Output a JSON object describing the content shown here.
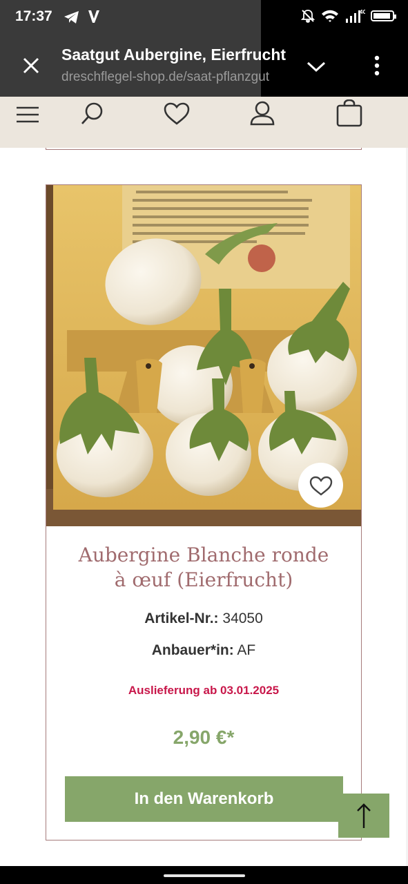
{
  "status_bar": {
    "time": "17:37",
    "left_icons": [
      "telegram-icon",
      "v-app-icon"
    ],
    "right_icons": [
      "mute-icon",
      "wifi-icon",
      "signal-icon",
      "battery-icon"
    ],
    "network": "4G"
  },
  "browser": {
    "title": "Saatgut Aubergine, Eierfrucht",
    "url": "dreschflegel-shop.de/saat-pflanzgut"
  },
  "site_nav": {
    "icons": [
      "menu-icon",
      "search-icon",
      "heart-icon",
      "user-icon",
      "bag-icon"
    ]
  },
  "product": {
    "title_line1": "Aubergine Blanche ronde",
    "title_line2": "à œuf (Eierfrucht)",
    "article_label": "Artikel-Nr.:",
    "article_number": "34050",
    "grower_label": "Anbauer*in:",
    "grower_value": "AF",
    "delivery": "Auslieferung ab 03.01.2025",
    "price": "2,90 €*",
    "cart_button": "In den Warenkorb"
  },
  "colors": {
    "accent_green": "#86a66a",
    "title_rose": "#a06b6e",
    "delivery_red": "#c8174a",
    "nav_bg": "#ece6dd"
  }
}
